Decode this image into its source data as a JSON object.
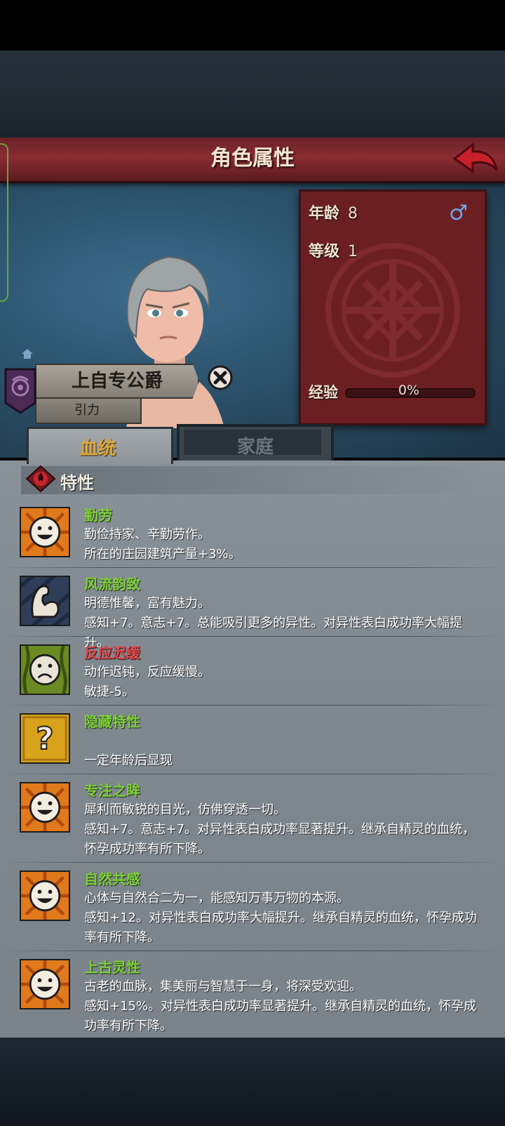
{
  "header": {
    "title": "角色属性"
  },
  "character": {
    "name": "上自专公爵",
    "subtitle": "引力",
    "age_label": "年龄",
    "age": "8",
    "level_label": "等级",
    "level": "1",
    "exp_label": "经验",
    "exp_text": "0%",
    "exp_progress": 0,
    "gender": "♂"
  },
  "tabs": [
    {
      "label": "血统",
      "active": true
    },
    {
      "label": "家庭",
      "active": false
    }
  ],
  "section": {
    "title": "特性"
  },
  "traits": [
    {
      "name": "勤劳",
      "type": "positive",
      "icon": "smile-sun-icon",
      "line1": "勤俭持家、辛勤劳作。",
      "line2": "所在的庄园建筑产量+3%。"
    },
    {
      "name": "风流韵致",
      "type": "positive",
      "icon": "flexed-arm-icon",
      "line1": "明德惟馨，富有魅力。",
      "line2": "感知+7。意志+7。总能吸引更多的异性。对异性表白成功率大幅提升。"
    },
    {
      "name": "反应迟缓",
      "type": "negative",
      "icon": "sad-face-icon",
      "line1": "动作迟钝，反应缓慢。",
      "line2": "敏捷-5。"
    },
    {
      "name": "隐藏特性",
      "type": "hidden",
      "icon": "question-mark-icon",
      "line1": "",
      "line2": "一定年龄后显现"
    },
    {
      "name": "专注之眸",
      "type": "positive",
      "icon": "smile-sun-icon",
      "line1": "犀利而敏锐的目光，仿佛穿透一切。",
      "line2": "感知+7。意志+7。对异性表白成功率显著提升。继承自精灵的血统，怀孕成功率有所下降。"
    },
    {
      "name": "自然共感",
      "type": "positive",
      "icon": "smile-sun-icon",
      "line1": "心体与自然合二为一，能感知万事万物的本源。",
      "line2": "感知+12。对异性表白成功率大幅提升。继承自精灵的血统，怀孕成功率有所下降。"
    },
    {
      "name": "上古灵性",
      "type": "positive",
      "icon": "smile-sun-icon",
      "line1": "古老的血脉，集美丽与智慧于一身，将深受欢迎。",
      "line2": "感知+15%。对异性表白成功率显著提升。继承自精灵的血统，怀孕成功率有所下降。"
    }
  ]
}
